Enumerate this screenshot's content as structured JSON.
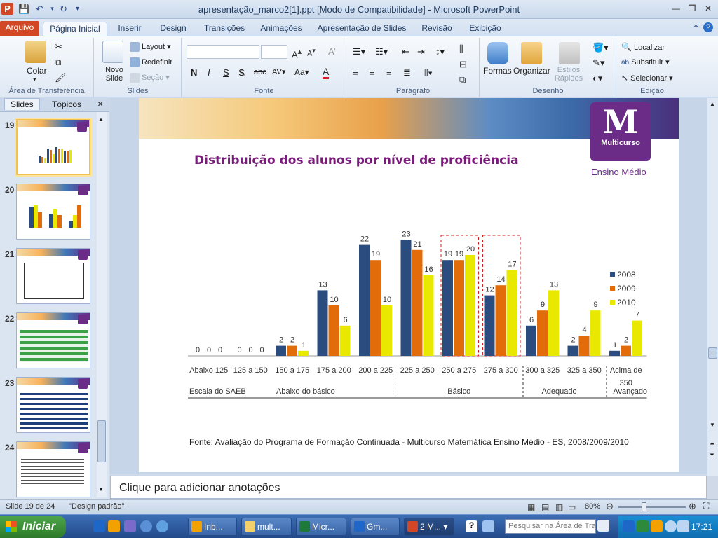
{
  "window": {
    "title": "apresentação_marco2[1].ppt [Modo de Compatibilidade]  -  Microsoft PowerPoint"
  },
  "tabs": [
    {
      "label": "Arquivo"
    },
    {
      "label": "Página Inicial"
    },
    {
      "label": "Inserir"
    },
    {
      "label": "Design"
    },
    {
      "label": "Transições"
    },
    {
      "label": "Animações"
    },
    {
      "label": "Apresentação de Slides"
    },
    {
      "label": "Revisão"
    },
    {
      "label": "Exibição"
    }
  ],
  "ribbon": {
    "groups": {
      "clipboard": "Área de Transferência",
      "slides": "Slides",
      "font": "Fonte",
      "paragraph": "Parágrafo",
      "drawing": "Desenho",
      "editing": "Edição"
    },
    "colar": "Colar",
    "novo_slide": "Novo Slide",
    "layout": "Layout",
    "redefinir": "Redefinir",
    "secao": "Seção",
    "formas": "Formas",
    "organizar": "Organizar",
    "estilos_rapidos": "Estilos Rápidos",
    "localizar": "Localizar",
    "substituir": "Substituir",
    "selecionar": "Selecionar"
  },
  "left_panel": {
    "tab_slides": "Slides",
    "tab_topicos": "Tópicos",
    "close": "×",
    "thumbs": [
      {
        "num": "19"
      },
      {
        "num": "20"
      },
      {
        "num": "21"
      },
      {
        "num": "22"
      },
      {
        "num": "23"
      },
      {
        "num": "24"
      }
    ]
  },
  "slide": {
    "title": "Distribuição dos alunos por nível de proficiência",
    "logo_letter": "M",
    "logo_text": "Multicurso",
    "logo_subtitle": "Ensino Médio",
    "source": "Fonte: Avaliação do Programa de Formação Continuada - Multicurso Matemática Ensino Médio - ES, 2008/2009/2010"
  },
  "chart_data": {
    "type": "bar",
    "categories": [
      "Abaixo 125",
      "125 a 150",
      "150 a 175",
      "175 a 200",
      "200 a 225",
      "225 a 250",
      "250 a 275",
      "275 a 300",
      "300 a 325",
      "325 a 350",
      "Acima de 350"
    ],
    "series": [
      {
        "name": "2008",
        "color": "#2b4c7e",
        "values": [
          0,
          0,
          2,
          13,
          22,
          23,
          19,
          12,
          6,
          2,
          1
        ]
      },
      {
        "name": "2009",
        "color": "#e36c0a",
        "values": [
          0,
          0,
          2,
          10,
          19,
          21,
          19,
          14,
          9,
          4,
          2
        ]
      },
      {
        "name": "2010",
        "color": "#e8e800",
        "values": [
          0,
          0,
          1,
          6,
          10,
          16,
          20,
          17,
          13,
          9,
          7
        ]
      }
    ],
    "ylim": [
      0,
      25
    ],
    "legend": "right",
    "scale_labels": [
      "Escala do SAEB",
      "Abaixo do básico",
      "Básico",
      "Adequado",
      "Avançado"
    ]
  },
  "notes": {
    "placeholder": "Clique para adicionar anotações"
  },
  "status": {
    "slide": "Slide 19 de 24",
    "theme": "\"Design padrão\"",
    "zoom": "80%"
  },
  "taskbar": {
    "start": "Iniciar",
    "buttons": [
      {
        "label": "Inb..."
      },
      {
        "label": "mult..."
      },
      {
        "label": "Micr..."
      },
      {
        "label": "Gm..."
      },
      {
        "label": "2 M..."
      }
    ],
    "search_placeholder": "Pesquisar na Área de Trab",
    "clock": "17:21"
  }
}
